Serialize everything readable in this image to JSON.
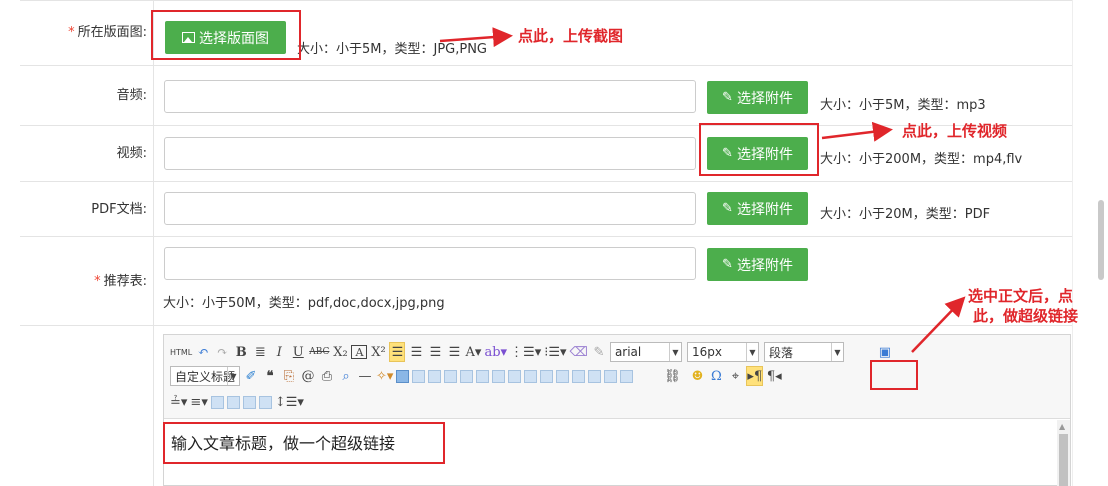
{
  "form": {
    "cover": {
      "label": "所在版面图:",
      "required": true,
      "button": "选择版面图",
      "hint": "大小：小于5M，类型：JPG,PNG"
    },
    "audio": {
      "label": "音频:",
      "button": "选择附件",
      "hint": "大小：小于5M，类型：mp3",
      "value": ""
    },
    "video": {
      "label": "视频:",
      "button": "选择附件",
      "hint": "大小：小于200M，类型：mp4,flv",
      "value": ""
    },
    "pdf": {
      "label": "PDF文档:",
      "button": "选择附件",
      "hint": "大小：小于20M，类型：PDF",
      "value": ""
    },
    "recommend": {
      "label": "推荐表:",
      "required": true,
      "button": "选择附件",
      "hint": "大小：小于50M，类型：pdf,doc,docx,jpg,png",
      "value": ""
    }
  },
  "editor": {
    "font_family": "arial",
    "font_size": "16px",
    "paragraph": "段落",
    "custom_title": "自定义标题",
    "html_label": "HTML",
    "content": "输入文章标题，做一个超级链接"
  },
  "annotations": {
    "upload_cover": "点此，上传截图",
    "upload_video": "点此，上传视频",
    "link_line1": "选中正文后，点",
    "link_line2": "此，做超级链接"
  },
  "colors": {
    "button_green": "#4cae4c",
    "annotation_red": "#e0262b",
    "required_star": "#e43"
  }
}
